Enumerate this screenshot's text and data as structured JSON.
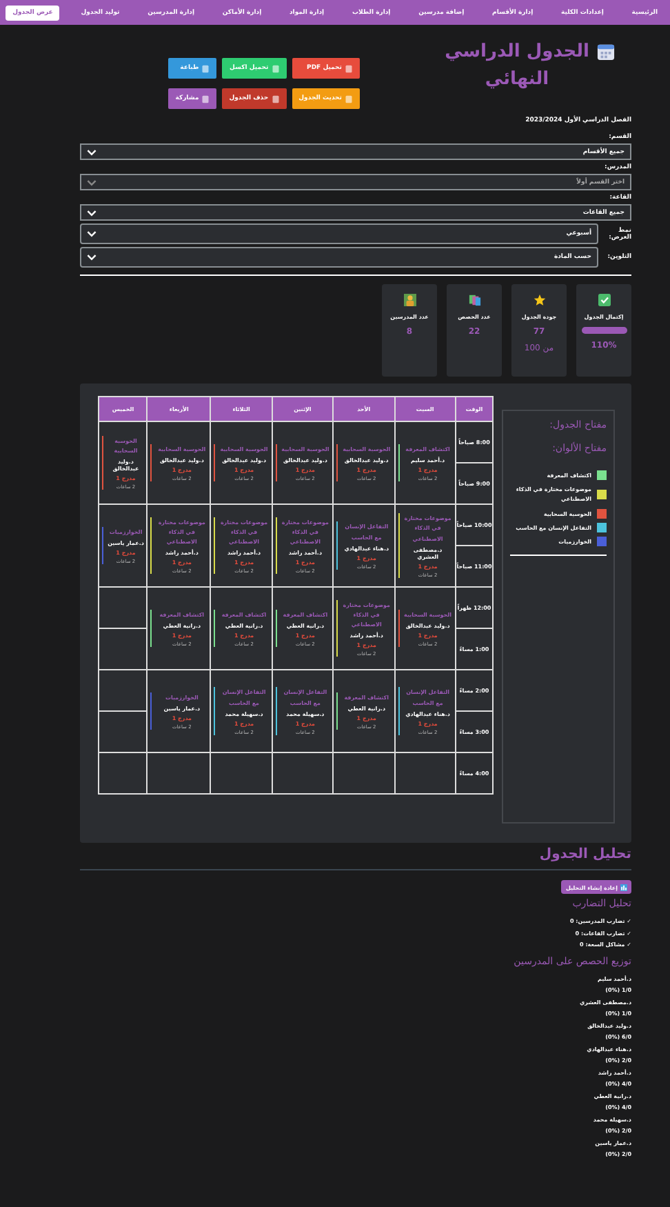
{
  "nav": [
    {
      "label": "الرئيسية",
      "selected": false
    },
    {
      "label": "إعدادات الكلية",
      "selected": false
    },
    {
      "label": "إدارة الأقسام",
      "selected": false
    },
    {
      "label": "إضافة مدرسين",
      "selected": false
    },
    {
      "label": "إدارة الطلاب",
      "selected": false
    },
    {
      "label": "إدارة المواد",
      "selected": false
    },
    {
      "label": "إدارة الأماكن",
      "selected": false
    },
    {
      "label": "إدارة المدرسين",
      "selected": false
    },
    {
      "label": "توليد الجدول",
      "selected": false
    },
    {
      "label": "عرض الجدول",
      "selected": true
    }
  ],
  "title": "الجدول الدراسي النهائي",
  "actions": [
    {
      "label": "تحميل PDF",
      "color": "#e74c3c"
    },
    {
      "label": "تحميل اكسل",
      "color": "#2ecc71"
    },
    {
      "label": "طباعة",
      "color": "#3498db"
    },
    {
      "label": "تحديث الجدول",
      "color": "#f39c12"
    },
    {
      "label": "حذف الجدول",
      "color": "#c0392b"
    },
    {
      "label": "مشاركة",
      "color": "#9b59b6"
    }
  ],
  "semester": "الفصل الدراسي الأول 2023/2024",
  "filters": [
    {
      "kind": "stacked",
      "label": "القسم:",
      "value": "جميع الأقسام",
      "disabled": false
    },
    {
      "kind": "stacked",
      "label": "المدرس:",
      "value": "اختر القسم أولاً",
      "disabled": true
    },
    {
      "kind": "stacked",
      "label": "القاعة:",
      "value": "جميع القاعات",
      "disabled": false
    },
    {
      "kind": "inline",
      "label": "نمط العرض:",
      "value": "أسبوعي",
      "disabled": false
    },
    {
      "kind": "inline",
      "label": "التلوين:",
      "value": "حسب المادة",
      "disabled": false
    }
  ],
  "stats": [
    {
      "kind": "progress",
      "label": "إكتمال الجدول",
      "level": 1,
      "value": "110%"
    },
    {
      "kind": "score",
      "label": "جودة الجدول",
      "value": "77",
      "sub": "من 100"
    },
    {
      "kind": "count",
      "label": "عدد الحصص",
      "value": "22"
    },
    {
      "kind": "count",
      "label": "عدد المدرسين",
      "value": "8"
    }
  ],
  "table": {
    "columns": [
      "الوقت",
      "السبت",
      "الأحد",
      "الإثنين",
      "الثلاثاء",
      "الأربعاء",
      "الخميس"
    ],
    "blocks": [
      {
        "times": [
          "8:00 صباحاً",
          "9:00 صباحاً"
        ],
        "cells": [
          {
            "kind": "session",
            "subject": "اكتشاف المعرفة",
            "teacher": "د.أحمد سليم",
            "room": "مدرج 1",
            "duration": "2 ساعات",
            "color": "#7be08f"
          },
          {
            "kind": "session",
            "subject": "الحوسبة السحابية",
            "teacher": "د.وليد عبدالخالق",
            "room": "مدرج 1",
            "duration": "2 ساعات",
            "color": "#e0533f"
          },
          {
            "kind": "session",
            "subject": "الحوسبة السحابية",
            "teacher": "د.وليد عبدالخالق",
            "room": "مدرج 1",
            "duration": "2 ساعات",
            "color": "#e0533f"
          },
          {
            "kind": "session",
            "subject": "الحوسبة السحابية",
            "teacher": "د.وليد عبدالخالق",
            "room": "مدرج 1",
            "duration": "2 ساعات",
            "color": "#e0533f"
          },
          {
            "kind": "session",
            "subject": "الحوسبة السحابية",
            "teacher": "د.وليد عبدالخالق",
            "room": "مدرج 1",
            "duration": "2 ساعات",
            "color": "#e0533f"
          },
          {
            "kind": "session",
            "subject": "الحوسبة السحابية",
            "teacher": "د.وليد عبدالخالق",
            "room": "مدرج 1",
            "duration": "2 ساعات",
            "color": "#e0533f"
          }
        ]
      },
      {
        "times": [
          "10:00 صباحاً",
          "11:00 صباحاً"
        ],
        "cells": [
          {
            "kind": "session",
            "subject": "موضوعات مختارة في الذكاء الاصطناعي",
            "teacher": "د.مصطفى العشري",
            "room": "مدرج 1",
            "duration": "2 ساعات",
            "color": "#d9dc4a"
          },
          {
            "kind": "session",
            "subject": "التفاعل الإنسان مع الحاسب",
            "teacher": "د.هناء عبدالهادي",
            "room": "مدرج 1",
            "duration": "2 ساعات",
            "color": "#4cc3dd"
          },
          {
            "kind": "session",
            "subject": "موضوعات مختارة في الذكاء الاصطناعي",
            "teacher": "د.أحمد راشد",
            "room": "مدرج 1",
            "duration": "2 ساعات",
            "color": "#d9dc4a"
          },
          {
            "kind": "session",
            "subject": "موضوعات مختارة في الذكاء الاصطناعي",
            "teacher": "د.أحمد راشد",
            "room": "مدرج 1",
            "duration": "2 ساعات",
            "color": "#d9dc4a"
          },
          {
            "kind": "session",
            "subject": "موضوعات مختارة في الذكاء الاصطناعي",
            "teacher": "د.أحمد راشد",
            "room": "مدرج 1",
            "duration": "2 ساعات",
            "color": "#d9dc4a"
          },
          {
            "kind": "session",
            "subject": "الخوارزميات",
            "teacher": "د.عمار ياسين",
            "room": "مدرج 1",
            "duration": "2 ساعات",
            "color": "#4a5fd8"
          }
        ]
      },
      {
        "times": [
          "12:00 ظهراً",
          "1:00 مساءً"
        ],
        "cells": [
          {
            "kind": "session",
            "subject": "الحوسبة السحابية",
            "teacher": "د.وليد عبدالخالق",
            "room": "مدرج 1",
            "duration": "2 ساعات",
            "color": "#e0533f"
          },
          {
            "kind": "session",
            "subject": "موضوعات مختارة في الذكاء الاصطناعي",
            "teacher": "د.أحمد راشد",
            "room": "مدرج 1",
            "duration": "2 ساعات",
            "color": "#d9dc4a"
          },
          {
            "kind": "session",
            "subject": "اكتشاف المعرفة",
            "teacher": "د.رانية العطي",
            "room": "مدرج 1",
            "duration": "2 ساعات",
            "color": "#7be08f"
          },
          {
            "kind": "session",
            "subject": "اكتشاف المعرفة",
            "teacher": "د.رانية العطي",
            "room": "مدرج 1",
            "duration": "2 ساعات",
            "color": "#7be08f"
          },
          {
            "kind": "session",
            "subject": "اكتشاف المعرفة",
            "teacher": "د.رانية العطي",
            "room": "مدرج 1",
            "duration": "2 ساعات",
            "color": "#7be08f"
          },
          {
            "kind": "empty"
          }
        ]
      },
      {
        "times": [
          "2:00 مساءً",
          "3:00 مساءً"
        ],
        "cells": [
          {
            "kind": "session",
            "subject": "التفاعل الإنسان مع الحاسب",
            "teacher": "د.هناء عبدالهادي",
            "room": "مدرج 1",
            "duration": "2 ساعات",
            "color": "#4cc3dd"
          },
          {
            "kind": "session",
            "subject": "اكتشاف المعرفة",
            "teacher": "د.رانية العطي",
            "room": "مدرج 1",
            "duration": "2 ساعات",
            "color": "#7be08f"
          },
          {
            "kind": "session",
            "subject": "التفاعل الإنسان مع الحاسب",
            "teacher": "د.سهيلة محمد",
            "room": "مدرج 1",
            "duration": "2 ساعات",
            "color": "#4cc3dd"
          },
          {
            "kind": "session",
            "subject": "التفاعل الإنسان مع الحاسب",
            "teacher": "د.سهيلة محمد",
            "room": "مدرج 1",
            "duration": "2 ساعات",
            "color": "#4cc3dd"
          },
          {
            "kind": "session",
            "subject": "الخوارزميات",
            "teacher": "د.عمار ياسين",
            "room": "مدرج 1",
            "duration": "2 ساعات",
            "color": "#4a5fd8"
          },
          {
            "kind": "empty"
          }
        ]
      },
      {
        "times": [
          "4:00 مساءً"
        ],
        "cells": [
          {
            "kind": "empty"
          },
          {
            "kind": "empty"
          },
          {
            "kind": "empty"
          },
          {
            "kind": "empty"
          },
          {
            "kind": "empty"
          },
          {
            "kind": "empty"
          }
        ]
      }
    ]
  },
  "legend": {
    "title": "مفتاح الجدول:",
    "subtitle": "مفتاح الألوان:",
    "items": [
      {
        "label": "اكتشاف المعرفة",
        "color": "#7be08f"
      },
      {
        "label": "موضوعات مختارة في الذكاء الاصطناعي",
        "color": "#d9dc4a"
      },
      {
        "label": "الحوسبة السحابية",
        "color": "#e0533f"
      },
      {
        "label": "التفاعل الإنسان مع الحاسب",
        "color": "#4cc3dd"
      },
      {
        "label": "الخوارزميات",
        "color": "#4a5fd8"
      }
    ]
  },
  "analysis": {
    "title": "تحليل الجدول",
    "refresh": "إعادة إنشاء التحليل",
    "conflicts_title": "تحليل التضارب",
    "conflicts": [
      "✓ تضارب المدرسين: 0",
      "✓ تضارب القاعات: 0",
      "✓ مشاكل السعة: 0"
    ],
    "distribution_title": "توزيع الحصص على المدرسين",
    "distribution": [
      {
        "name": "د.أحمد سليم",
        "count": "1/0 (0%)"
      },
      {
        "name": "د.مصطفى العشري",
        "count": "1/0 (0%)"
      },
      {
        "name": "د.وليد عبدالخالق",
        "count": "6/0 (0%)"
      },
      {
        "name": "د.هناء عبدالهادي",
        "count": "2/0 (0%)"
      },
      {
        "name": "د.أحمد راشد",
        "count": "4/0 (0%)"
      },
      {
        "name": "د.رانية العطي",
        "count": "4/0 (0%)"
      },
      {
        "name": "د.سهيلة محمد",
        "count": "2/0 (0%)"
      },
      {
        "name": "د.عمار ياسين",
        "count": "2/0 (0%)"
      }
    ]
  }
}
